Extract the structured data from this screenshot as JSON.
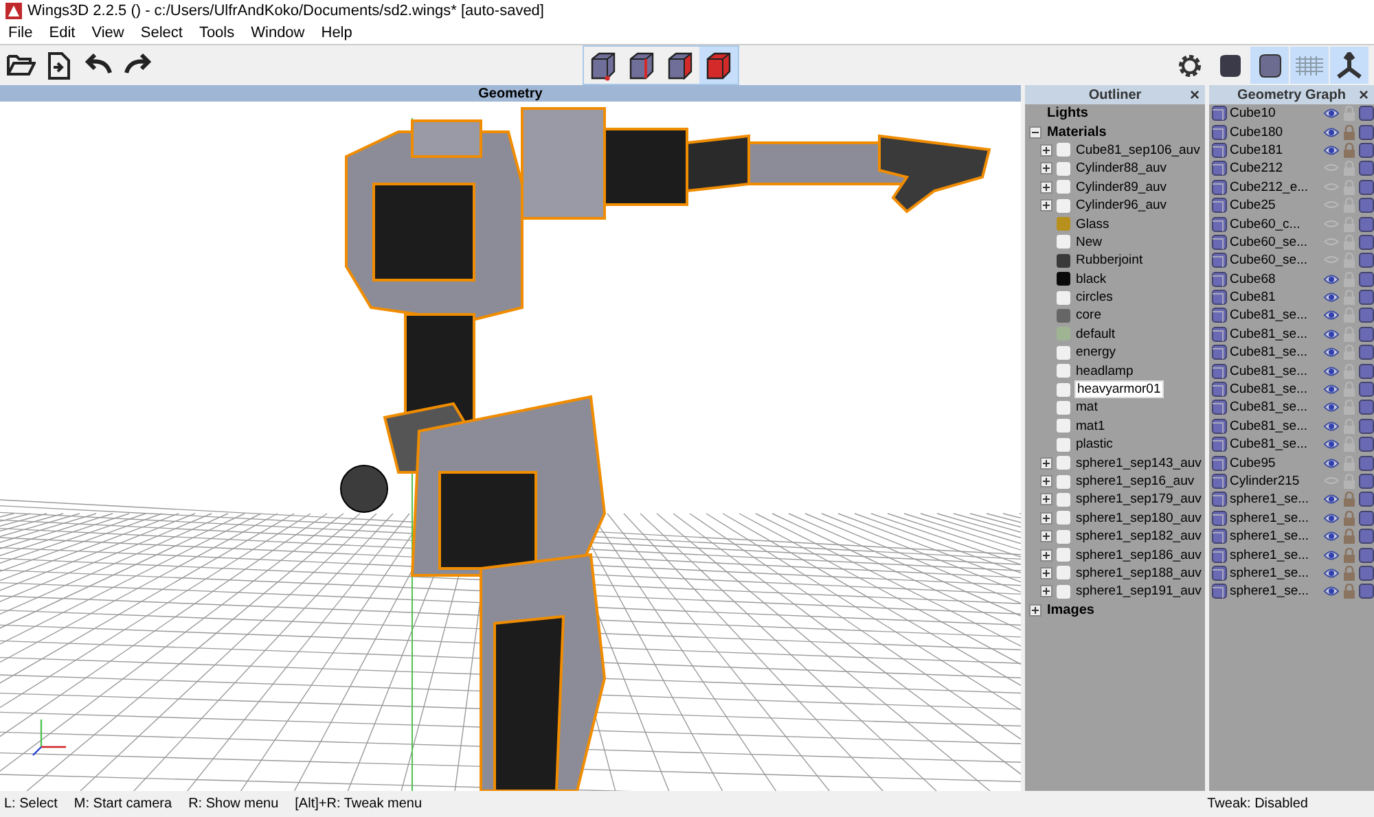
{
  "window": {
    "title": "Wings3D 2.2.5 () - c:/Users/UlfrAndKoko/Documents/sd2.wings* [auto-saved]"
  },
  "menu": [
    "File",
    "Edit",
    "View",
    "Select",
    "Tools",
    "Window",
    "Help"
  ],
  "select_modes": [
    {
      "kind": "vertex",
      "selected": false
    },
    {
      "kind": "edge",
      "selected": false
    },
    {
      "kind": "body",
      "selected": false
    },
    {
      "kind": "face",
      "selected": true
    }
  ],
  "view_toggles": [
    {
      "kind": "gear",
      "on": false
    },
    {
      "kind": "smooth",
      "on": false
    },
    {
      "kind": "cube",
      "on": true
    },
    {
      "kind": "grid",
      "on": true
    },
    {
      "kind": "axes",
      "on": true
    }
  ],
  "viewport": {
    "title": "Geometry"
  },
  "outliner": {
    "title": "Outliner",
    "close": "×",
    "items": [
      {
        "label": "Lights",
        "kind": "empty"
      },
      {
        "label": "Materials",
        "kind": "folder",
        "expanded": true,
        "children": [
          {
            "label": "Cube81_sep106_auv",
            "kind": "group",
            "color": "#f0f0f0",
            "selected": false
          },
          {
            "label": "Cylinder88_auv",
            "kind": "group",
            "color": "#f0f0f0",
            "selected": false
          },
          {
            "label": "Cylinder89_auv",
            "kind": "group",
            "color": "#f0f0f0",
            "selected": false
          },
          {
            "label": "Cylinder96_auv",
            "kind": "group",
            "color": "#f0f0f0",
            "selected": false
          },
          {
            "label": "Glass",
            "kind": "material",
            "color": "#b8901e",
            "selected": false
          },
          {
            "label": "New",
            "kind": "material",
            "color": "#f0f0f0",
            "selected": false
          },
          {
            "label": "Rubberjoint",
            "kind": "material",
            "color": "#3a3a3a",
            "selected": false
          },
          {
            "label": "black",
            "kind": "material",
            "color": "#0a0a0a",
            "selected": false
          },
          {
            "label": "circles",
            "kind": "material",
            "color": "#f0f0f0",
            "selected": false
          },
          {
            "label": "core",
            "kind": "material",
            "color": "#666666",
            "selected": false
          },
          {
            "label": "default",
            "kind": "material",
            "color": "#9fb493",
            "selected": false
          },
          {
            "label": "energy",
            "kind": "material",
            "color": "#f0f0f0",
            "selected": false
          },
          {
            "label": "headlamp",
            "kind": "material",
            "color": "#f0f0f0",
            "selected": false
          },
          {
            "label": "heavyarmor01",
            "kind": "material",
            "color": "#f0f0f0",
            "selected": true
          },
          {
            "label": "mat",
            "kind": "material",
            "color": "#f0f0f0",
            "selected": false
          },
          {
            "label": "mat1",
            "kind": "material",
            "color": "#f0f0f0",
            "selected": false
          },
          {
            "label": "plastic",
            "kind": "material",
            "color": "#f0f0f0",
            "selected": false
          },
          {
            "label": "sphere1_sep143_auv",
            "kind": "group",
            "color": "#f0f0f0",
            "selected": false
          },
          {
            "label": "sphere1_sep16_auv",
            "kind": "group",
            "color": "#f0f0f0",
            "selected": false
          },
          {
            "label": "sphere1_sep179_auv",
            "kind": "group",
            "color": "#f0f0f0",
            "selected": false
          },
          {
            "label": "sphere1_sep180_auv",
            "kind": "group",
            "color": "#f0f0f0",
            "selected": false
          },
          {
            "label": "sphere1_sep182_auv",
            "kind": "group",
            "color": "#f0f0f0",
            "selected": false
          },
          {
            "label": "sphere1_sep186_auv",
            "kind": "group",
            "color": "#f0f0f0",
            "selected": false
          },
          {
            "label": "sphere1_sep188_auv",
            "kind": "group",
            "color": "#f0f0f0",
            "selected": false
          },
          {
            "label": "sphere1_sep191_auv",
            "kind": "group",
            "color": "#f0f0f0",
            "selected": false
          }
        ]
      },
      {
        "label": "Images",
        "kind": "folder",
        "expanded": false
      }
    ]
  },
  "geometry_graph": {
    "title": "Geometry Graph",
    "close": "×",
    "rows": [
      {
        "name": "Cube10",
        "visible": true,
        "locked": false
      },
      {
        "name": "Cube180",
        "visible": true,
        "locked": true
      },
      {
        "name": "Cube181",
        "visible": true,
        "locked": true
      },
      {
        "name": "Cube212",
        "visible": false,
        "locked": false
      },
      {
        "name": "Cube212_e...",
        "visible": false,
        "locked": false
      },
      {
        "name": "Cube25",
        "visible": false,
        "locked": false
      },
      {
        "name": "Cube60_c...",
        "visible": false,
        "locked": false
      },
      {
        "name": "Cube60_se...",
        "visible": false,
        "locked": false
      },
      {
        "name": "Cube60_se...",
        "visible": false,
        "locked": false
      },
      {
        "name": "Cube68",
        "visible": true,
        "locked": false
      },
      {
        "name": "Cube81",
        "visible": true,
        "locked": false
      },
      {
        "name": "Cube81_se...",
        "visible": true,
        "locked": false
      },
      {
        "name": "Cube81_se...",
        "visible": true,
        "locked": false
      },
      {
        "name": "Cube81_se...",
        "visible": true,
        "locked": false
      },
      {
        "name": "Cube81_se...",
        "visible": true,
        "locked": false
      },
      {
        "name": "Cube81_se...",
        "visible": true,
        "locked": false
      },
      {
        "name": "Cube81_se...",
        "visible": true,
        "locked": false
      },
      {
        "name": "Cube81_se...",
        "visible": true,
        "locked": false
      },
      {
        "name": "Cube81_se...",
        "visible": true,
        "locked": false
      },
      {
        "name": "Cube95",
        "visible": true,
        "locked": false
      },
      {
        "name": "Cylinder215",
        "visible": false,
        "locked": false
      },
      {
        "name": "sphere1_se...",
        "visible": true,
        "locked": true
      },
      {
        "name": "sphere1_se...",
        "visible": true,
        "locked": true
      },
      {
        "name": "sphere1_se...",
        "visible": true,
        "locked": true
      },
      {
        "name": "sphere1_se...",
        "visible": true,
        "locked": true
      },
      {
        "name": "sphere1_se...",
        "visible": true,
        "locked": true
      },
      {
        "name": "sphere1_se...",
        "visible": true,
        "locked": true
      }
    ]
  },
  "status_bar": {
    "hints": [
      "L: Select",
      "M: Start camera",
      "R: Show menu",
      "[Alt]+R: Tweak menu"
    ],
    "tweak": "Tweak: Disabled"
  }
}
